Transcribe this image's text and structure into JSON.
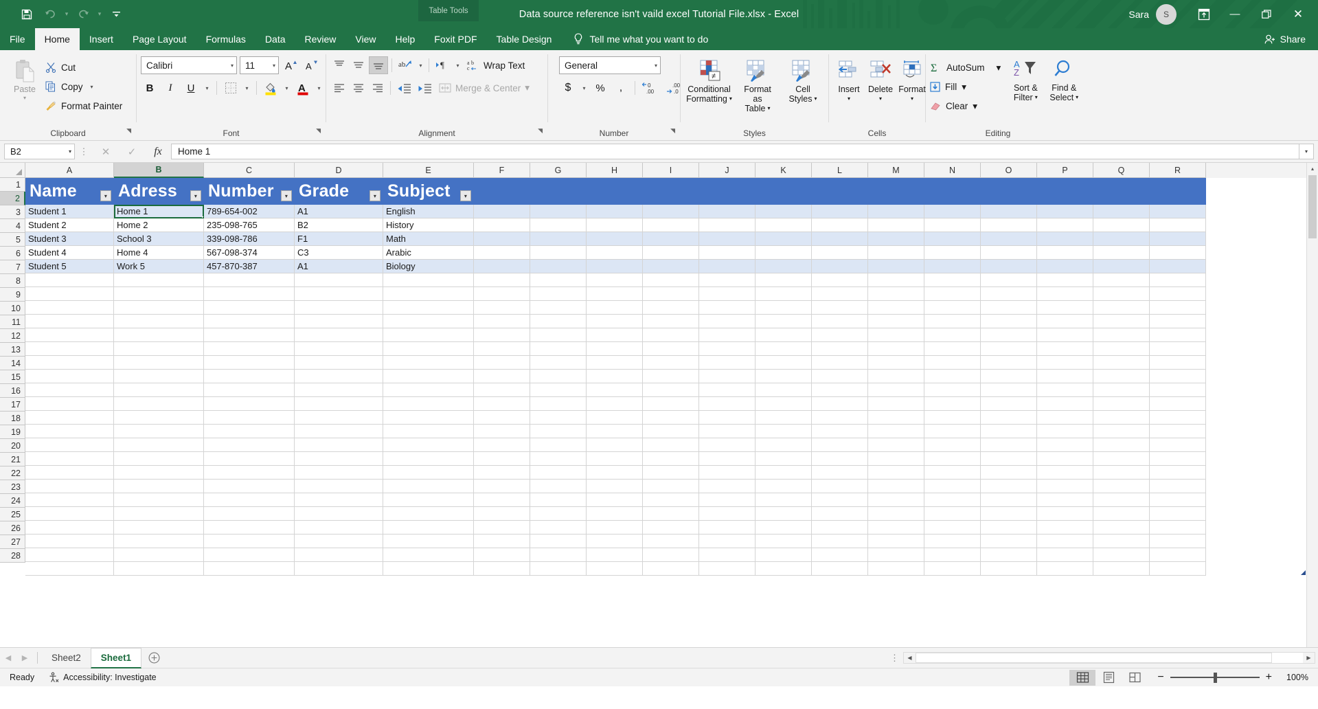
{
  "titlebar": {
    "quick_access": [
      "save-icon",
      "undo-icon",
      "redo-icon",
      "customize-icon"
    ],
    "document_title": "Data source reference isn't vaild excel Tutorial File.xlsx  -  Excel",
    "contextual_tool": "Table Tools",
    "user_name": "Sara",
    "avatar_initial": "S",
    "window_buttons": {
      "minimize": "—",
      "restore": "❐",
      "close": "✕"
    }
  },
  "tabs": {
    "items": [
      {
        "label": "File",
        "active": false
      },
      {
        "label": "Home",
        "active": true
      },
      {
        "label": "Insert",
        "active": false
      },
      {
        "label": "Page Layout",
        "active": false
      },
      {
        "label": "Formulas",
        "active": false
      },
      {
        "label": "Data",
        "active": false
      },
      {
        "label": "Review",
        "active": false
      },
      {
        "label": "View",
        "active": false
      },
      {
        "label": "Help",
        "active": false
      },
      {
        "label": "Foxit PDF",
        "active": false
      },
      {
        "label": "Table Design",
        "active": false
      }
    ],
    "tell_me": "Tell me what you want to do",
    "share": "Share"
  },
  "ribbon": {
    "clipboard": {
      "group_name": "Clipboard",
      "paste": "Paste",
      "cut": "Cut",
      "copy": "Copy",
      "format_painter": "Format Painter"
    },
    "font": {
      "group_name": "Font",
      "font_family": "Calibri",
      "font_size": "11",
      "grow": "A",
      "shrink": "A",
      "bold": "B",
      "italic": "I",
      "underline": "U"
    },
    "alignment": {
      "group_name": "Alignment",
      "wrap_text": "Wrap Text",
      "merge_center": "Merge & Center"
    },
    "number": {
      "group_name": "Number",
      "format": "General",
      "currency": "$",
      "percent": "%",
      "comma": ","
    },
    "styles": {
      "group_name": "Styles",
      "conditional_formatting": "Conditional Formatting",
      "format_as_table": "Format as Table",
      "cell_styles": "Cell Styles"
    },
    "cells": {
      "group_name": "Cells",
      "insert": "Insert",
      "delete": "Delete",
      "format": "Format"
    },
    "editing": {
      "group_name": "Editing",
      "autosum": "AutoSum",
      "fill": "Fill",
      "clear": "Clear",
      "sort_filter": "Sort & Filter",
      "find_select": "Find & Select"
    }
  },
  "formula_bar": {
    "name_box": "B2",
    "cancel": "✕",
    "enter": "✓",
    "insert_function": "fx",
    "content": "Home 1"
  },
  "grid": {
    "columns": [
      "A",
      "B",
      "C",
      "D",
      "E",
      "F",
      "G",
      "H",
      "I",
      "J",
      "K",
      "L",
      "M",
      "N",
      "O",
      "P",
      "Q",
      "R"
    ],
    "selected_column": "B",
    "row_numbers": [
      1,
      2,
      3,
      4,
      5,
      6,
      7,
      8,
      9,
      10,
      11,
      12,
      13,
      14,
      15,
      16,
      17,
      18,
      19,
      20,
      21,
      22,
      23,
      24,
      25,
      26,
      27,
      28
    ],
    "selected_row": 2,
    "table": {
      "headers": [
        "Name",
        "Adress",
        "Number",
        "Grade",
        "Subject"
      ],
      "rows": [
        [
          "Student 1",
          "Home 1",
          "789-654-002",
          "A1",
          "English"
        ],
        [
          "Student 2",
          "Home 2",
          "235-098-765",
          "B2",
          "History"
        ],
        [
          "Student 3",
          "School 3",
          "339-098-786",
          "F1",
          "Math"
        ],
        [
          "Student 4",
          "Home 4",
          "567-098-374",
          "C3",
          "Arabic"
        ],
        [
          "Student 5",
          "Work 5",
          "457-870-387",
          "A1",
          "Biology"
        ]
      ],
      "header_fill": "#4472c4",
      "band_fill": "#dce6f5",
      "active_cell": "B2",
      "active_cell_value": "Home 1"
    }
  },
  "sheets": {
    "items": [
      {
        "label": "Sheet2",
        "active": false
      },
      {
        "label": "Sheet1",
        "active": true
      }
    ],
    "add_label": "+"
  },
  "status_bar": {
    "mode": "Ready",
    "accessibility": "Accessibility: Investigate",
    "views": [
      "normal-view-icon",
      "page-layout-view-icon",
      "page-break-view-icon"
    ],
    "zoom_out": "−",
    "zoom_in": "+",
    "zoom_level": "100%"
  }
}
